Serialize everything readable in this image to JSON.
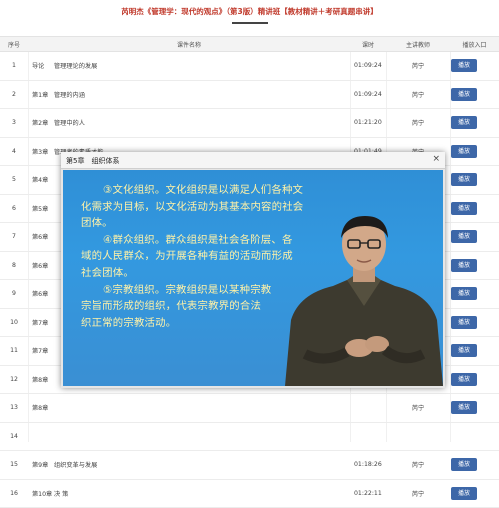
{
  "title": "芮明杰《管理学：现代的观点》（第3版）精讲班【教材精讲＋考研真题串讲】",
  "table": {
    "headers": [
      "序号",
      "课件名称",
      "课时",
      "主讲教师",
      "播放入口"
    ],
    "rows": [
      {
        "no": "1",
        "chapter": "导论",
        "name": "管理理论的发展",
        "time": "01:09:24",
        "teacher": "芮宁",
        "play": "播放"
      },
      {
        "no": "2",
        "chapter": "第1章",
        "name": "管理的内涵",
        "time": "01:09:24",
        "teacher": "芮宁",
        "play": "播放"
      },
      {
        "no": "3",
        "chapter": "第2章",
        "name": "管理中的人",
        "time": "01:21:20",
        "teacher": "芮宁",
        "play": "播放"
      },
      {
        "no": "4",
        "chapter": "第3章",
        "name": "管理者的素质才能",
        "time": "01:01:49",
        "teacher": "芮宁",
        "play": "播放"
      },
      {
        "no": "5",
        "chapter": "第4章",
        "name": "",
        "time": "",
        "teacher": "芮宁",
        "play": "播放"
      },
      {
        "no": "6",
        "chapter": "第5章",
        "name": "",
        "time": "",
        "teacher": "芮宁",
        "play": "播放"
      },
      {
        "no": "7",
        "chapter": "第6章",
        "name": "",
        "time": "",
        "teacher": "芮宁",
        "play": "播放"
      },
      {
        "no": "8",
        "chapter": "第6章",
        "name": "",
        "time": "",
        "teacher": "芮宁",
        "play": "播放"
      },
      {
        "no": "9",
        "chapter": "第6章",
        "name": "",
        "time": "",
        "teacher": "芮宁",
        "play": "播放"
      },
      {
        "no": "10",
        "chapter": "第7章",
        "name": "",
        "time": "",
        "teacher": "芮宁",
        "play": "播放"
      },
      {
        "no": "11",
        "chapter": "第7章",
        "name": "",
        "time": "",
        "teacher": "芮宁",
        "play": "播放"
      },
      {
        "no": "12",
        "chapter": "第8章",
        "name": "",
        "time": "",
        "teacher": "芮宁",
        "play": "播放"
      },
      {
        "no": "13",
        "chapter": "第8章",
        "name": "",
        "time": "",
        "teacher": "芮宁",
        "play": "播放"
      },
      {
        "no": "14",
        "chapter": "",
        "name": "",
        "time": "",
        "teacher": "",
        "play": ""
      },
      {
        "no": "15",
        "chapter": "第9章",
        "name": "组织变革与发展",
        "time": "01:18:26",
        "teacher": "芮宁",
        "play": "播放"
      },
      {
        "no": "16",
        "chapter": "第10章",
        "name": "决 策",
        "time": "01:22:11",
        "teacher": "芮宁",
        "play": "播放"
      }
    ]
  },
  "player": {
    "title": "第5章　组织体系",
    "close": "×",
    "slide": [
      "③文化组织。文化组织是以满足人们各种文",
      "化需求为目标，以文化活动为其基本内容的社会",
      "团体。",
      "④群众组织。群众组织是社会各阶层、各",
      "域的人民群众，为开展各种有益的活动而形成",
      "社会团体。",
      "⑤宗教组织。宗教组织是以某种宗教",
      "宗旨而形成的组织，代表宗教界的合法",
      "织正常的宗教活动。"
    ]
  },
  "colors": {
    "title": "#c0392b",
    "play_button": "#3d67a8",
    "slide_bg": "#3399e0",
    "slide_text": "#fff2a8"
  }
}
